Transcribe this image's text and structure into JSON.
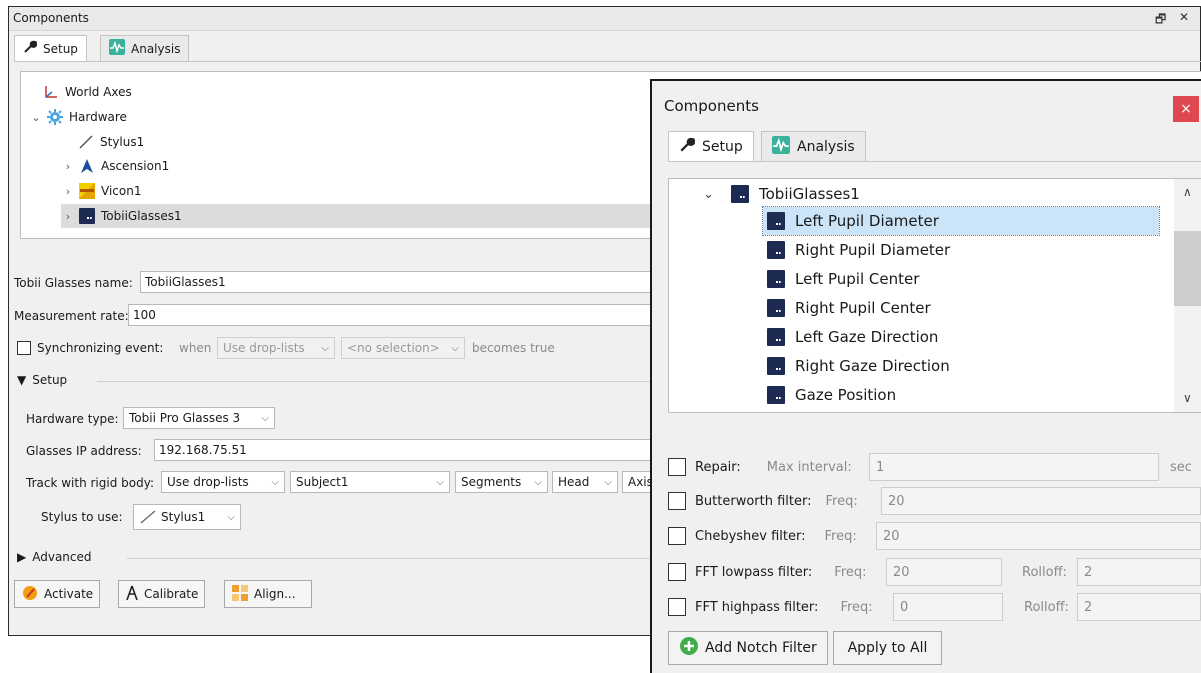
{
  "main_window": {
    "title": "Components",
    "window_buttons": [
      "🗗",
      "✕"
    ],
    "tabs": [
      {
        "label": "Setup",
        "icon": "wrench-icon"
      },
      {
        "label": "Analysis",
        "icon": "waveform-icon"
      }
    ],
    "tree": [
      {
        "label": "World Axes",
        "icon": "axes-icon",
        "arrow": ""
      },
      {
        "label": "Hardware",
        "icon": "gear-icon",
        "arrow": "⌄"
      },
      {
        "label": "Stylus1",
        "icon": "stylus-icon",
        "arrow": ""
      },
      {
        "label": "Ascension1",
        "icon": "ascension-icon",
        "arrow": "›"
      },
      {
        "label": "Vicon1",
        "icon": "vicon-icon",
        "arrow": "›"
      },
      {
        "label": "TobiiGlasses1",
        "icon": "tobii-icon",
        "arrow": "›",
        "selected": true
      }
    ],
    "form": {
      "name_label": "Tobii Glasses name:",
      "name_value": "TobiiGlasses1",
      "rate_label": "Measurement rate:",
      "rate_value": "100",
      "sync_label": "Synchronizing event:",
      "sync_when": "when",
      "sync_combo1": "Use drop-lists",
      "sync_combo2": "<no selection>",
      "sync_tail": "becomes true",
      "setup_section": "Setup",
      "hw_type_label": "Hardware type:",
      "hw_type_value": "Tobii Pro Glasses 3",
      "ip_label": "Glasses IP address:",
      "ip_value": "192.168.75.51",
      "track_label": "Track with rigid body:",
      "track_combo1": "Use drop-lists",
      "track_combo2": "Subject1",
      "track_combo3": "Segments",
      "track_combo4": "Head",
      "track_combo5": "Axis",
      "stylus_label": "Stylus to use:",
      "stylus_value": "Stylus1",
      "advanced_section": "Advanced"
    },
    "buttons": {
      "activate": "Activate",
      "calibrate": "Calibrate",
      "align": "Align..."
    }
  },
  "overlay_window": {
    "title": "Components",
    "close": "×",
    "tabs": [
      {
        "label": "Setup",
        "icon": "wrench-icon"
      },
      {
        "label": "Analysis",
        "icon": "waveform-icon"
      }
    ],
    "tree_parent": "TobiiGlasses1",
    "tree_items": [
      {
        "label": "Left Pupil Diameter",
        "selected": true
      },
      {
        "label": "Right Pupil Diameter"
      },
      {
        "label": "Left Pupil Center"
      },
      {
        "label": "Right Pupil Center"
      },
      {
        "label": "Left Gaze Direction"
      },
      {
        "label": "Right Gaze Direction"
      },
      {
        "label": "Gaze Position"
      }
    ],
    "filters": {
      "repair_label": "Repair:",
      "repair_field_label": "Max interval:",
      "repair_value": "1",
      "repair_unit": "sec",
      "butterworth_label": "Butterworth filter:",
      "butterworth_freq_label": "Freq:",
      "butterworth_freq": "20",
      "chebyshev_label": "Chebyshev filter:",
      "chebyshev_freq_label": "Freq:",
      "chebyshev_freq": "20",
      "fft_low_label": "FFT lowpass filter:",
      "fft_low_freq_label": "Freq:",
      "fft_low_freq": "20",
      "fft_low_rolloff_label": "Rolloff:",
      "fft_low_rolloff": "2",
      "fft_high_label": "FFT highpass filter:",
      "fft_high_freq_label": "Freq:",
      "fft_high_freq": "0",
      "fft_high_rolloff_label": "Rolloff:",
      "fft_high_rolloff": "2"
    },
    "buttons": {
      "add_notch": "Add Notch Filter",
      "apply_all": "Apply to All"
    }
  },
  "colors": {
    "selection_blue": "#cce4f7",
    "tobii_navy": "#1d2a52",
    "close_red": "#e04850"
  }
}
